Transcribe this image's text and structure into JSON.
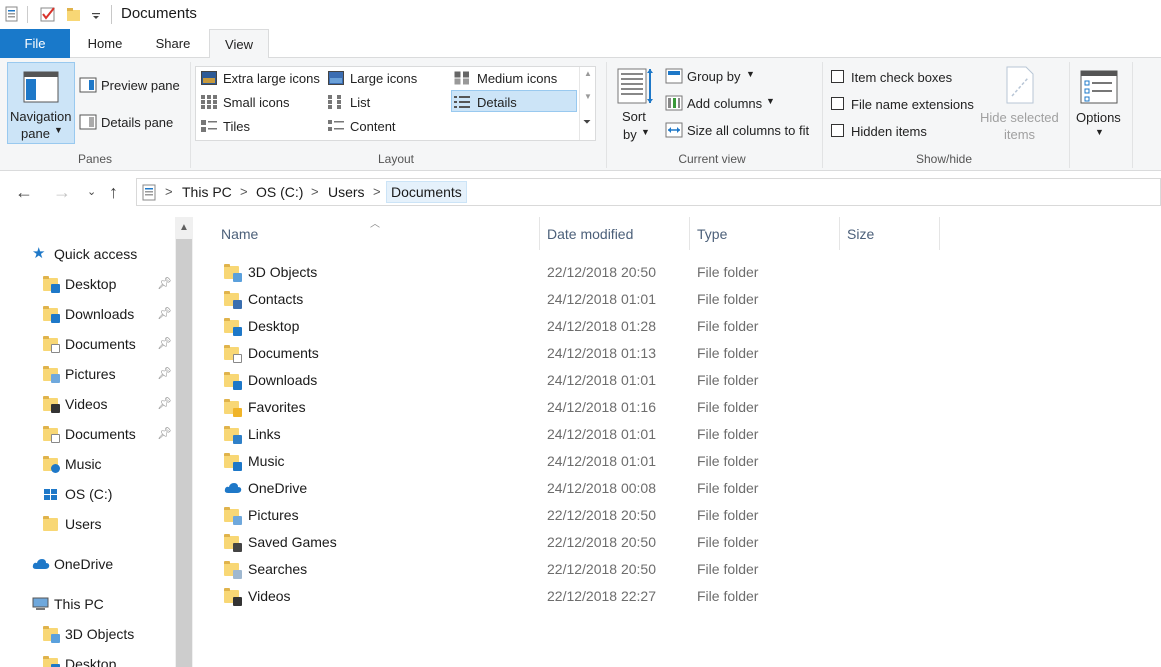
{
  "window": {
    "title": "Documents"
  },
  "ribbon_tabs": [
    {
      "label": "File"
    },
    {
      "label": "Home"
    },
    {
      "label": "Share"
    },
    {
      "label": "View"
    }
  ],
  "panes": {
    "group_label": "Panes",
    "navigation_pane": "Navigation",
    "navigation_pane_2": "pane",
    "preview_pane": "Preview pane",
    "details_pane": "Details pane"
  },
  "layout": {
    "group_label": "Layout",
    "extra_large_icons": "Extra large icons",
    "large_icons": "Large icons",
    "medium_icons": "Medium icons",
    "small_icons": "Small icons",
    "list": "List",
    "details": "Details",
    "tiles": "Tiles",
    "content": "Content",
    "selected": "Details"
  },
  "current_view": {
    "group_label": "Current view",
    "sort_by_1": "Sort",
    "sort_by_2": "by",
    "group_by": "Group by",
    "add_columns": "Add columns",
    "size_all_columns": "Size all columns to fit"
  },
  "show_hide": {
    "group_label": "Show/hide",
    "item_check_boxes": "Item check boxes",
    "file_name_extensions": "File name extensions",
    "hidden_items": "Hidden items",
    "hide_selected_1": "Hide selected",
    "hide_selected_2": "items"
  },
  "options": {
    "label": "Options"
  },
  "breadcrumb": [
    {
      "label": "This PC"
    },
    {
      "label": "OS (C:)"
    },
    {
      "label": "Users"
    },
    {
      "label": "Documents"
    }
  ],
  "nav_pane": {
    "quick_access": "Quick access",
    "items": [
      {
        "label": "Desktop",
        "pinned": true
      },
      {
        "label": "Downloads",
        "pinned": true
      },
      {
        "label": "Documents",
        "pinned": true
      },
      {
        "label": "Pictures",
        "pinned": true
      },
      {
        "label": "Videos",
        "pinned": true
      },
      {
        "label": "Documents",
        "pinned": true
      },
      {
        "label": "Music",
        "pinned": false
      },
      {
        "label": "OS (C:)",
        "pinned": false
      },
      {
        "label": "Users",
        "pinned": false
      }
    ],
    "onedrive": "OneDrive",
    "this_pc": "This PC",
    "this_pc_items": [
      {
        "label": "3D Objects"
      },
      {
        "label": "Desktop"
      }
    ]
  },
  "columns": {
    "name": "Name",
    "date_modified": "Date modified",
    "type": "Type",
    "size": "Size"
  },
  "files": [
    {
      "name": "3D Objects",
      "date": "22/12/2018 20:50",
      "type": "File folder",
      "icon": "3d-objects-folder-icon"
    },
    {
      "name": "Contacts",
      "date": "24/12/2018 01:01",
      "type": "File folder",
      "icon": "contacts-folder-icon"
    },
    {
      "name": "Desktop",
      "date": "24/12/2018 01:28",
      "type": "File folder",
      "icon": "desktop-folder-icon"
    },
    {
      "name": "Documents",
      "date": "24/12/2018 01:13",
      "type": "File folder",
      "icon": "documents-folder-icon"
    },
    {
      "name": "Downloads",
      "date": "24/12/2018 01:01",
      "type": "File folder",
      "icon": "downloads-folder-icon"
    },
    {
      "name": "Favorites",
      "date": "24/12/2018 01:16",
      "type": "File folder",
      "icon": "favorites-folder-icon"
    },
    {
      "name": "Links",
      "date": "24/12/2018 01:01",
      "type": "File folder",
      "icon": "links-folder-icon"
    },
    {
      "name": "Music",
      "date": "24/12/2018 01:01",
      "type": "File folder",
      "icon": "music-folder-icon"
    },
    {
      "name": "OneDrive",
      "date": "24/12/2018 00:08",
      "type": "File folder",
      "icon": "onedrive-cloud-icon"
    },
    {
      "name": "Pictures",
      "date": "22/12/2018 20:50",
      "type": "File folder",
      "icon": "pictures-folder-icon"
    },
    {
      "name": "Saved Games",
      "date": "22/12/2018 20:50",
      "type": "File folder",
      "icon": "saved-games-folder-icon"
    },
    {
      "name": "Searches",
      "date": "22/12/2018 20:50",
      "type": "File folder",
      "icon": "searches-folder-icon"
    },
    {
      "name": "Videos",
      "date": "22/12/2018 22:27",
      "type": "File folder",
      "icon": "videos-folder-icon"
    }
  ],
  "colors": {
    "file_tab": "#1979ca",
    "selection": "#cce4f7",
    "folder": "#f8d775",
    "accent_blue": "#1e78c8"
  }
}
